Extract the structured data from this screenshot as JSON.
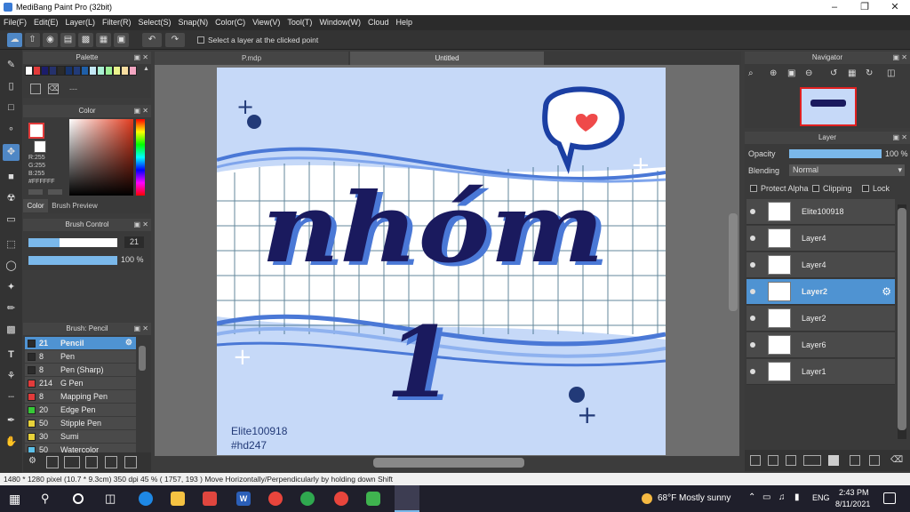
{
  "window": {
    "title": "MediBang Paint Pro (32bit)"
  },
  "menu": [
    "File(F)",
    "Edit(E)",
    "Layer(L)",
    "Filter(R)",
    "Select(S)",
    "Snap(N)",
    "Color(C)",
    "View(V)",
    "Tool(T)",
    "Window(W)",
    "Cloud",
    "Help"
  ],
  "toolbar": {
    "select_layer_label": "Select a layer at the clicked point"
  },
  "palette": {
    "title": "Palette",
    "swatches": [
      "#ffffff",
      "#e23b3b",
      "#1b1c6b",
      "#25316c",
      "#2b2b2b",
      "#17336b",
      "#223b78",
      "#1f5fa8",
      "#c3e7f5",
      "#a9f0d2",
      "#9cf098",
      "#eaf38c",
      "#f7dda0",
      "#f3a6c1"
    ],
    "dash": "---"
  },
  "color_panel": {
    "title": "Color",
    "r": "R:255",
    "g": "G:255",
    "b": "B:255",
    "hex": "#FFFFFF",
    "tab_color": "Color",
    "tab_preview": "Brush Preview"
  },
  "brush_control": {
    "title": "Brush Control",
    "size": "21",
    "opacity": "100 %",
    "size_fraction": 0.35,
    "opacity_fraction": 1.0
  },
  "brush_list": {
    "title": "Brush: Pencil",
    "items": [
      {
        "size": "21",
        "name": "Pencil",
        "color": "#2b2b2b",
        "selected": true
      },
      {
        "size": "8",
        "name": "Pen",
        "color": "#2b2b2b"
      },
      {
        "size": "8",
        "name": "Pen (Sharp)",
        "color": "#2b2b2b"
      },
      {
        "size": "214",
        "name": "G Pen",
        "color": "#e23b3b"
      },
      {
        "size": "8",
        "name": "Mapping Pen",
        "color": "#e23b3b"
      },
      {
        "size": "20",
        "name": "Edge Pen",
        "color": "#37c837"
      },
      {
        "size": "50",
        "name": "Stipple Pen",
        "color": "#e8d23a"
      },
      {
        "size": "30",
        "name": "Sumi",
        "color": "#e8d23a"
      },
      {
        "size": "50",
        "name": "Watercolor",
        "color": "#5cc0e8"
      }
    ]
  },
  "doc_tabs": [
    "P.mdp",
    "Untitled"
  ],
  "artwork": {
    "text_main": "nhóm",
    "text_number": "1",
    "signature_line1": "Elite100918",
    "signature_line2": "#hd247"
  },
  "navigator": {
    "title": "Navigator"
  },
  "layer_panel": {
    "title": "Layer",
    "opacity_label": "Opacity",
    "opacity_value": "100 %",
    "opacity_fraction": 1.0,
    "blending_label": "Blending",
    "blending_value": "Normal",
    "protect_alpha": "Protect Alpha",
    "clipping": "Clipping",
    "lock": "Lock",
    "layers": [
      {
        "name": "Elite100918"
      },
      {
        "name": "Layer4"
      },
      {
        "name": "Layer4"
      },
      {
        "name": "Layer2",
        "selected": true
      },
      {
        "name": "Layer2"
      },
      {
        "name": "Layer6"
      },
      {
        "name": "Layer1"
      }
    ]
  },
  "status": {
    "text": "1480 * 1280 pixel  (10.7 * 9.3cm)  350 dpi  45 %  ( 1757, 193 )  Move Horizontally/Perpendicularly by holding down Shift"
  },
  "taskbar": {
    "weather": "68°F  Mostly sunny",
    "lang": "ENG",
    "time": "2:43 PM",
    "date": "8/11/2021"
  }
}
